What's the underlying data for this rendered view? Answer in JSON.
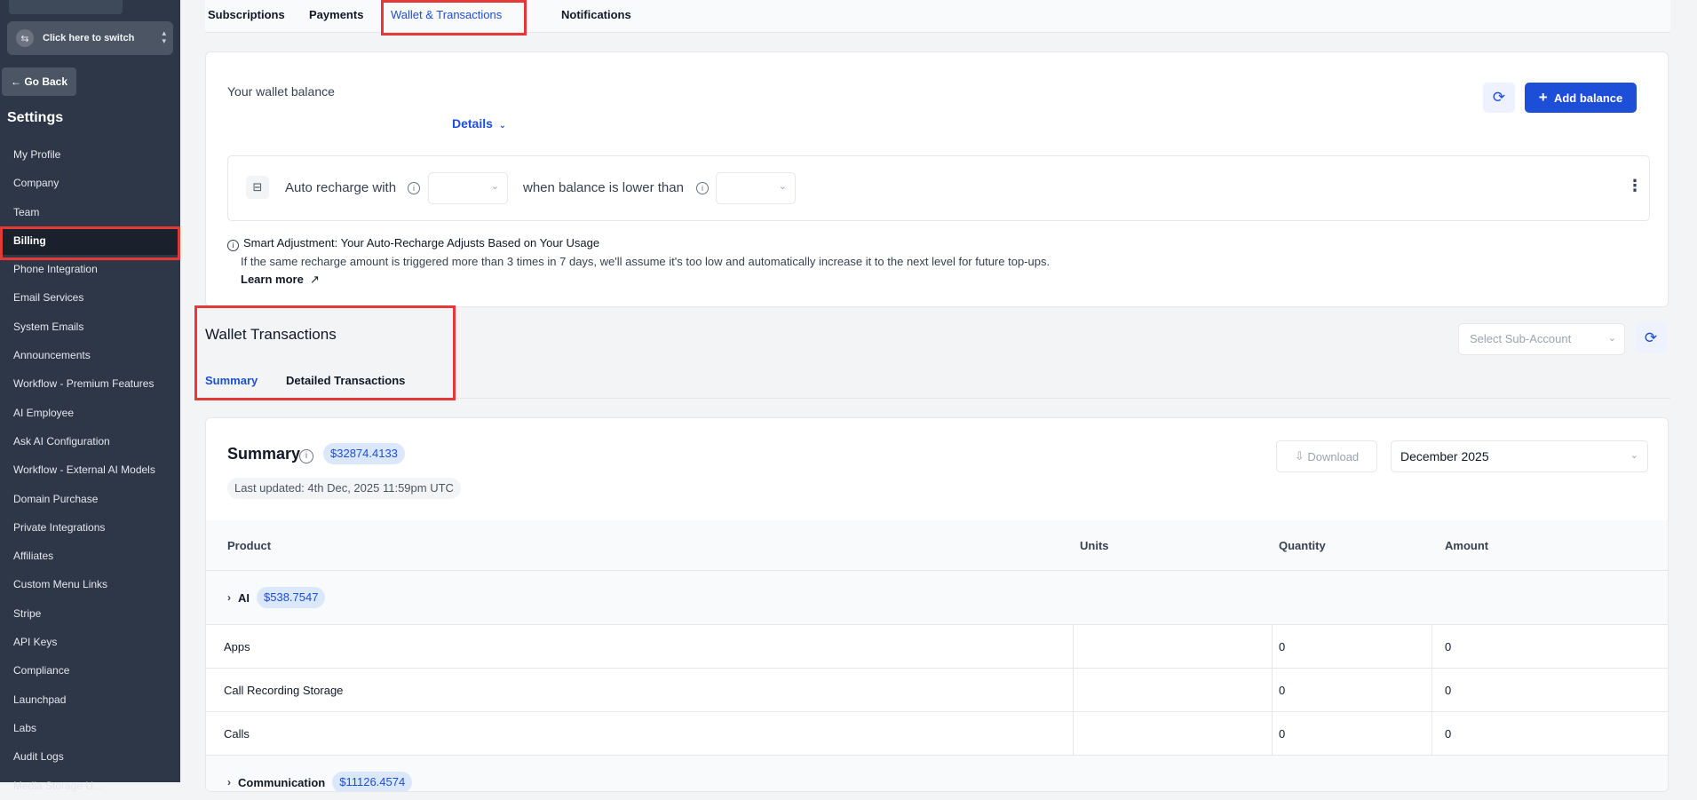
{
  "sidebar": {
    "switcher_label": "Click here to switch",
    "go_back": "Go Back",
    "settings_title": "Settings",
    "items": [
      {
        "label": "My Profile"
      },
      {
        "label": "Company"
      },
      {
        "label": "Team"
      },
      {
        "label": "Billing",
        "active": true
      },
      {
        "label": "Phone Integration"
      },
      {
        "label": "Email Services"
      },
      {
        "label": "System Emails"
      },
      {
        "label": "Announcements"
      },
      {
        "label": "Workflow - Premium Features"
      },
      {
        "label": "AI Employee"
      },
      {
        "label": "Ask AI Configuration"
      },
      {
        "label": "Workflow - External AI Models"
      },
      {
        "label": "Domain Purchase"
      },
      {
        "label": "Private Integrations"
      },
      {
        "label": "Affiliates"
      },
      {
        "label": "Custom Menu Links"
      },
      {
        "label": "Stripe"
      },
      {
        "label": "API Keys"
      },
      {
        "label": "Compliance"
      },
      {
        "label": "Launchpad"
      },
      {
        "label": "Labs"
      },
      {
        "label": "Audit Logs"
      },
      {
        "label": "Media Storage U..."
      }
    ]
  },
  "tabs": [
    {
      "label": "Subscriptions"
    },
    {
      "label": "Payments"
    },
    {
      "label": "Wallet & Transactions",
      "active": true
    },
    {
      "label": "Notifications"
    }
  ],
  "wallet": {
    "title": "Your wallet balance",
    "details": "Details",
    "add_balance": "Add balance",
    "auto_recharge_label": "Auto recharge with",
    "when_lower_label": "when balance is lower than",
    "smart_title": "Smart Adjustment: Your Auto-Recharge Adjusts Based on Your Usage",
    "smart_desc": "If the same recharge amount is triggered more than 3 times in 7 days, we'll assume it's too low and automatically increase it to the next level for future top-ups.",
    "learn_more": "Learn more"
  },
  "transactions": {
    "title": "Wallet Transactions",
    "tab_summary": "Summary",
    "tab_detailed": "Detailed Transactions",
    "subaccount_placeholder": "Select Sub-Account"
  },
  "summary": {
    "title": "Summary",
    "total": "$32874.4133",
    "last_updated": "Last updated: 4th Dec, 2025 11:59pm UTC",
    "download": "Download",
    "month": "December 2025",
    "columns": [
      "Product",
      "Units",
      "Quantity",
      "Amount"
    ],
    "groups": [
      {
        "name": "AI",
        "amount": "$538.7547"
      },
      {
        "name": "Communication",
        "amount": "$11126.4574"
      }
    ],
    "rows": [
      {
        "product": "Apps",
        "units": "",
        "quantity": "0",
        "amount": "0"
      },
      {
        "product": "Call Recording Storage",
        "units": "",
        "quantity": "0",
        "amount": "0"
      },
      {
        "product": "Calls",
        "units": "",
        "quantity": "0",
        "amount": "0"
      }
    ]
  },
  "colors": {
    "accent": "#1d4ed8",
    "sidebar_bg": "#2d3748",
    "highlight_red": "#e53935"
  }
}
